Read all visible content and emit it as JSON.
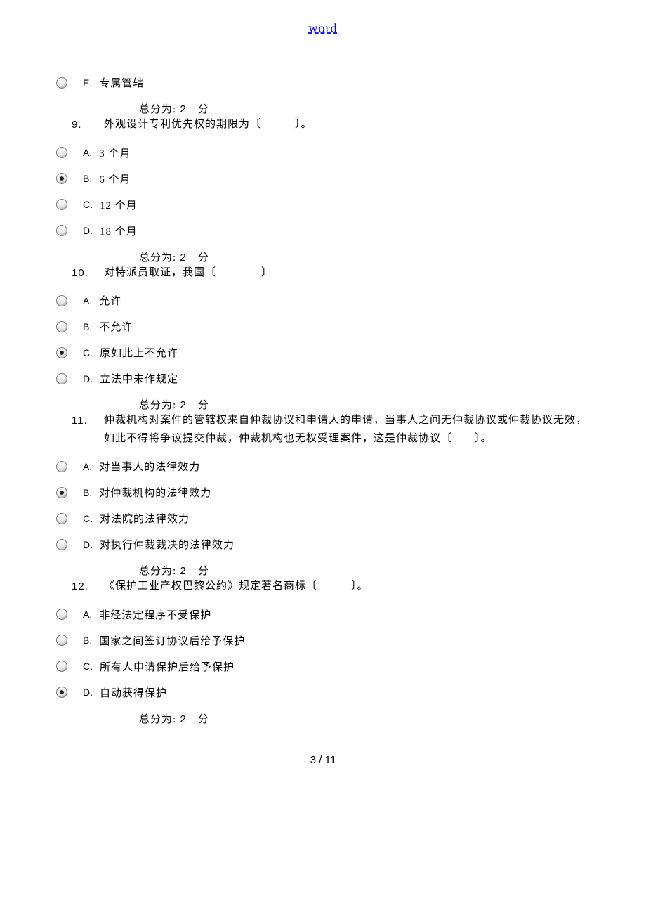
{
  "header_link": "word",
  "footer": "3 / 11",
  "blocks": [
    {
      "options": [
        {
          "letter": "E.",
          "text": "专属管辖",
          "selected": false
        }
      ],
      "score_label_a": "总分为:",
      "score_value": "2",
      "score_label_b": "分",
      "next_q_num": "9.",
      "next_q_text": "外观设计专利优先权的期限为〔　　　〕。"
    },
    {
      "options": [
        {
          "letter": "A.",
          "text": "3 个月",
          "selected": false
        },
        {
          "letter": "B.",
          "text": "6 个月",
          "selected": true
        },
        {
          "letter": "C.",
          "text": "12 个月",
          "selected": false
        },
        {
          "letter": "D.",
          "text": "18 个月",
          "selected": false
        }
      ],
      "score_label_a": "总分为:",
      "score_value": "2",
      "score_label_b": "分",
      "next_q_num": "10.",
      "next_q_text": "对特派员取证，我国〔　　　　〕"
    },
    {
      "options": [
        {
          "letter": "A.",
          "text": "允许",
          "selected": false
        },
        {
          "letter": "B.",
          "text": "不允许",
          "selected": false
        },
        {
          "letter": "C.",
          "text": "原如此上不允许",
          "selected": true
        },
        {
          "letter": "D.",
          "text": "立法中未作规定",
          "selected": false
        }
      ],
      "score_label_a": "总分为:",
      "score_value": "2",
      "score_label_b": "分",
      "next_q_num": "11.",
      "next_q_text": "仲裁机构对案件的管辖权来自仲裁协议和申请人的申请，当事人之间无仲裁协议或仲裁协议无效，如此不得将争议提交仲裁，仲裁机构也无权受理案件，这是仲裁协议〔　　〕。"
    },
    {
      "options": [
        {
          "letter": "A.",
          "text": "对当事人的法律效力",
          "selected": false
        },
        {
          "letter": "B.",
          "text": "对仲裁机构的法律效力",
          "selected": true
        },
        {
          "letter": "C.",
          "text": "对法院的法律效力",
          "selected": false
        },
        {
          "letter": "D.",
          "text": "对执行仲裁裁决的法律效力",
          "selected": false
        }
      ],
      "score_label_a": "总分为:",
      "score_value": "2",
      "score_label_b": "分",
      "next_q_num": "12.",
      "next_q_text": "《保护工业产权巴黎公约》规定著名商标〔　　　〕。"
    },
    {
      "options": [
        {
          "letter": "A.",
          "text": "非经法定程序不受保护",
          "selected": false
        },
        {
          "letter": "B.",
          "text": "国家之间签订协议后给予保护",
          "selected": false
        },
        {
          "letter": "C.",
          "text": "所有人申请保护后给予保护",
          "selected": false
        },
        {
          "letter": "D.",
          "text": "自动获得保护",
          "selected": true
        }
      ],
      "score_label_a": "总分为:",
      "score_value": "2",
      "score_label_b": "分"
    }
  ]
}
